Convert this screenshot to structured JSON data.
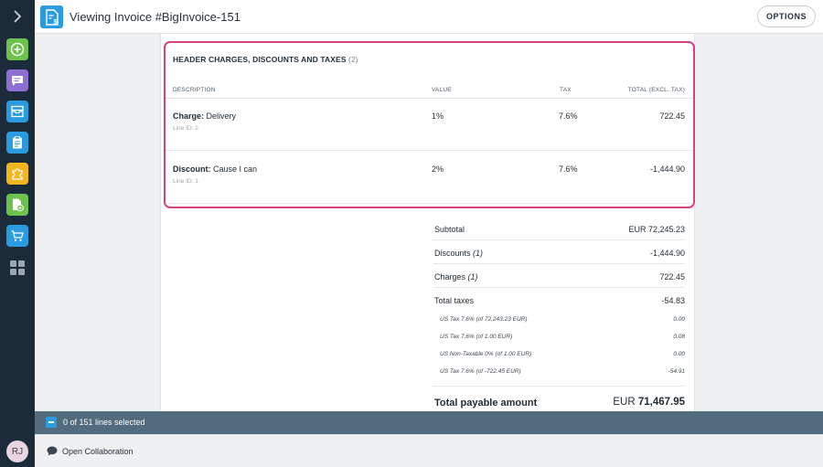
{
  "app": {
    "title": "Viewing Invoice #BigInvoice-151",
    "options_label": "OPTIONS",
    "accent": "#2b9be0",
    "highlight": "#d8417d"
  },
  "sidebar": {
    "expand_icon": "chevron-right-icon",
    "items": [
      {
        "name": "create",
        "icon": "plus-circle-icon",
        "color": "#6cc24a"
      },
      {
        "name": "messages",
        "icon": "chat-icon",
        "color": "#8e6fd1"
      },
      {
        "name": "inbox",
        "icon": "inbox-tray-icon",
        "color": "#2b9be0"
      },
      {
        "name": "orders",
        "icon": "clipboard-icon",
        "color": "#2b9be0"
      },
      {
        "name": "integrations",
        "icon": "puzzle-icon",
        "color": "#f2b51b"
      },
      {
        "name": "new-document",
        "icon": "document-add-icon",
        "color": "#6cc24a"
      },
      {
        "name": "shop",
        "icon": "cart-icon",
        "color": "#2b9be0"
      },
      {
        "name": "apps",
        "icon": "grid-icon",
        "color": "#9aa6b1"
      }
    ],
    "avatar_initials": "RJ"
  },
  "charges": {
    "title": "HEADER CHARGES, DISCOUNTS AND TAXES",
    "count": "(2)",
    "columns": {
      "description": "DESCRIPTION",
      "value": "VALUE",
      "tax": "TAX",
      "total": "TOTAL (EXCL. TAX)"
    },
    "rows": [
      {
        "kind": "Charge:",
        "name": "Delivery",
        "line_id": "Line ID: 2",
        "value": "1%",
        "tax": "7.6%",
        "total": "722.45"
      },
      {
        "kind": "Discount:",
        "name": "Cause I can",
        "line_id": "Line ID: 1",
        "value": "2%",
        "tax": "7.6%",
        "total": "-1,444.90"
      }
    ]
  },
  "summary": {
    "subtotal": {
      "label": "Subtotal",
      "amount": "EUR 72,245.23"
    },
    "discounts": {
      "label": "Discounts",
      "count": "(1)",
      "amount": "-1,444.90"
    },
    "charges": {
      "label": "Charges",
      "count": "(1)",
      "amount": "722.45"
    },
    "total_taxes": {
      "label": "Total taxes",
      "amount": "-54.83"
    },
    "tax_lines": [
      {
        "label": "US Tax 7.6% (of 72,243.23 EUR)",
        "amount": "0.00"
      },
      {
        "label": "US Tax 7.6% (of 1.00 EUR)",
        "amount": "0.08"
      },
      {
        "label": "US Non-Taxable 0% (of 1.00 EUR)",
        "amount": "0.00"
      },
      {
        "label": "US Tax 7.6% (of -722.45 EUR)",
        "amount": "-54.91"
      }
    ],
    "grand_total": {
      "label": "Total payable amount",
      "currency": "EUR",
      "amount": "71,467.95"
    }
  },
  "selection": {
    "text": "0 of 151 lines selected"
  },
  "footer": {
    "collab_label": "Open Collaboration"
  }
}
